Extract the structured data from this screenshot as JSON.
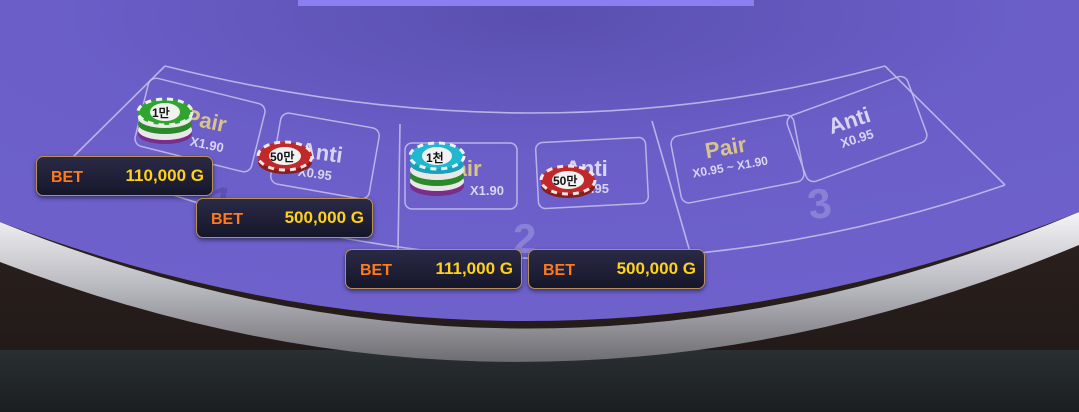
{
  "table": {
    "colors": {
      "felt": "#6a5cc4",
      "line": "#c9c2ee",
      "pair_text": "#d8c48a",
      "anti_text": "#d9d4f2",
      "bet_label": "#ff7a1a",
      "bet_amount": "#ffd11a"
    },
    "zones": [
      {
        "number": "1",
        "pair_label": "Pair",
        "pair_multiplier": "X1.90",
        "anti_label": "Anti",
        "anti_multiplier": "X0.95"
      },
      {
        "number": "2",
        "pair_label": "Pair",
        "pair_multiplier": "X1.90",
        "anti_label": "Anti",
        "anti_multiplier": "X0.95"
      },
      {
        "number": "3",
        "pair_label": "Pair",
        "pair_multiplier": "X0.95 ~ X1.90",
        "anti_label": "Anti",
        "anti_multiplier": "X0.95"
      }
    ]
  },
  "chips": [
    {
      "label": "1만",
      "color": "green"
    },
    {
      "label": "50만",
      "color": "red"
    },
    {
      "label": "1천",
      "color": "cyan"
    },
    {
      "label": "50만",
      "color": "red"
    }
  ],
  "bets": [
    {
      "label": "BET",
      "amount": "110,000 G"
    },
    {
      "label": "BET",
      "amount": "500,000 G"
    },
    {
      "label": "BET",
      "amount": "111,000 G"
    },
    {
      "label": "BET",
      "amount": "500,000 G"
    }
  ]
}
